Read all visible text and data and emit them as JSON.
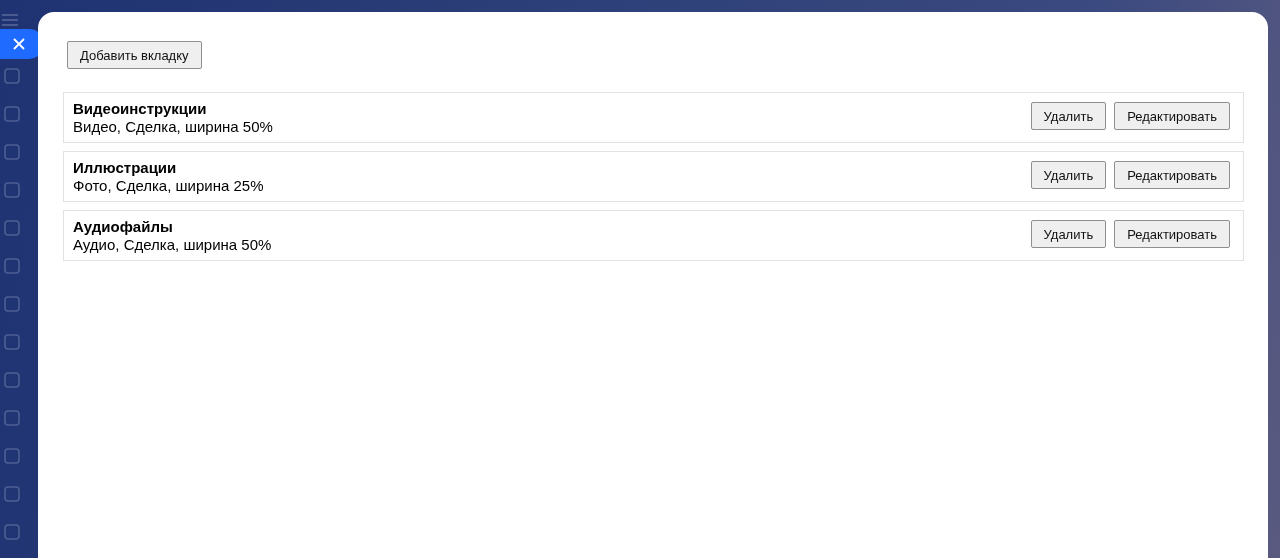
{
  "add_button": "Добавить вкладку",
  "tabs": [
    {
      "title": "Видеоинструкции",
      "details": "Видео, Сделка, ширина 50%",
      "delete": "Удалить",
      "edit": "Редактировать"
    },
    {
      "title": "Иллюстрации",
      "details": "Фото, Сделка, ширина 25%",
      "delete": "Удалить",
      "edit": "Редактировать"
    },
    {
      "title": "Аудиофайлы",
      "details": "Аудио, Сделка, ширина 50%",
      "delete": "Удалить",
      "edit": "Редактировать"
    }
  ]
}
